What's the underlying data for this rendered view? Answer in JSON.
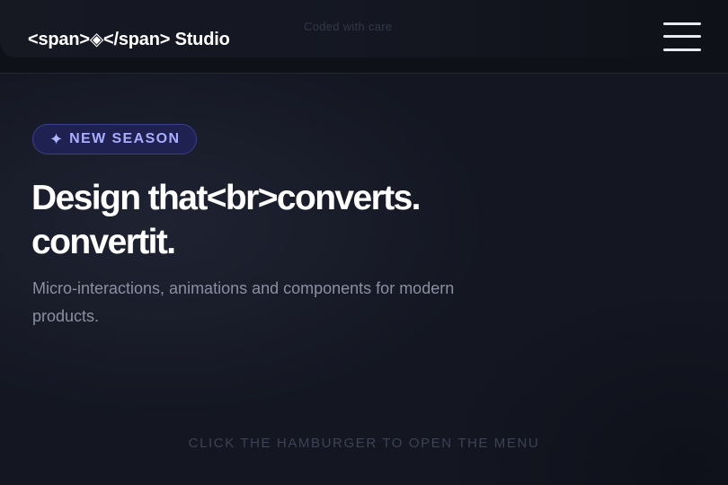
{
  "header": {
    "logo": "<span>◈</span> Studio",
    "ghost_label": "Coded with care",
    "menu_icon": "hamburger-icon"
  },
  "hero": {
    "badge_icon": "sparkle-icon",
    "badge_icon_glyph": "✦",
    "badge_label": "NEW SEASON",
    "headline_line1": "Design that<br>converts.",
    "headline_line2": "convertit.",
    "subtitle": "Micro-interactions, animations and components for modern products."
  },
  "footer": {
    "hint": "CLICK THE HAMBURGER TO OPEN THE MENU"
  },
  "colors": {
    "background": "#141722",
    "header_bg": "#0f1118",
    "badge_bg": "#1f2150",
    "badge_border": "#3b3f8e",
    "badge_text": "#a9adff",
    "headline": "#ffffff",
    "subtitle": "#8a90a2",
    "hint": "#3d4254"
  }
}
